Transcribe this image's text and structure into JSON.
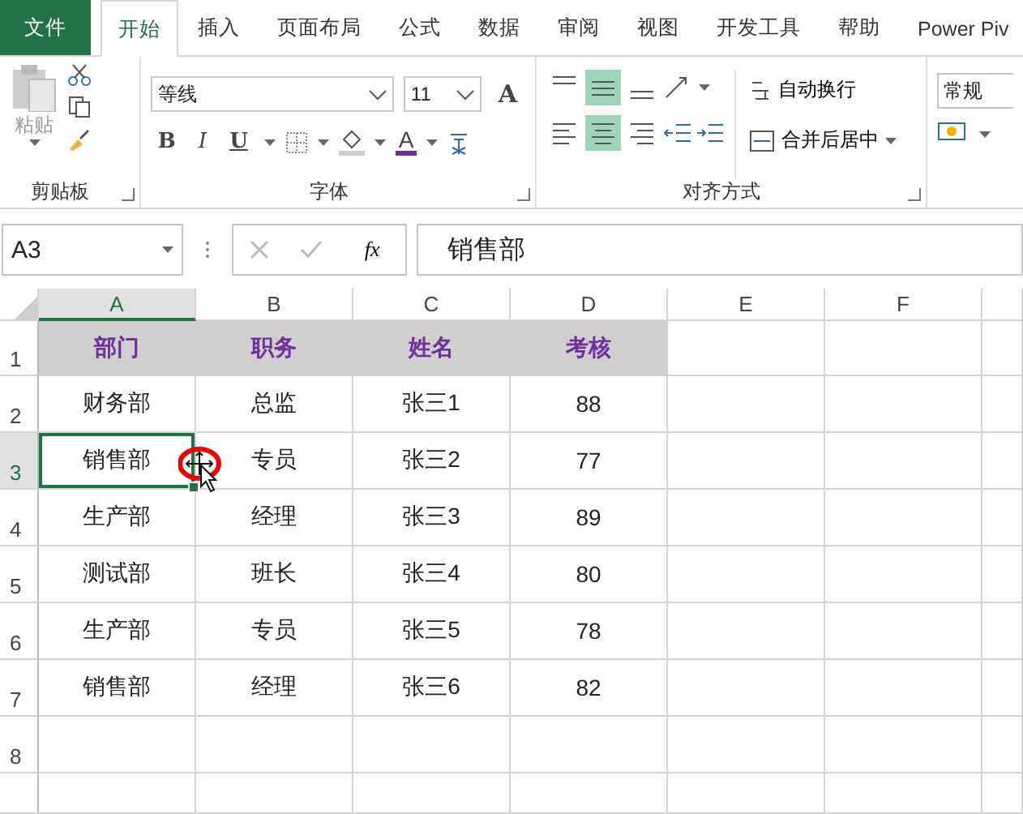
{
  "ribbon_tabs": [
    {
      "label": "文件",
      "kind": "file",
      "selected": false
    },
    {
      "label": "开始",
      "kind": "tab",
      "selected": true
    },
    {
      "label": "插入",
      "kind": "tab",
      "selected": false
    },
    {
      "label": "页面布局",
      "kind": "tab",
      "selected": false
    },
    {
      "label": "公式",
      "kind": "tab",
      "selected": false
    },
    {
      "label": "数据",
      "kind": "tab",
      "selected": false
    },
    {
      "label": "审阅",
      "kind": "tab",
      "selected": false
    },
    {
      "label": "视图",
      "kind": "tab",
      "selected": false
    },
    {
      "label": "开发工具",
      "kind": "tab",
      "selected": false
    },
    {
      "label": "帮助",
      "kind": "tab",
      "selected": false
    },
    {
      "label": "Power Piv",
      "kind": "tab",
      "selected": false
    }
  ],
  "clipboard": {
    "paste": "粘贴",
    "label": "剪贴板"
  },
  "font": {
    "name": "等线",
    "size": "11",
    "grow": "A",
    "styles": [
      "B",
      "I",
      "U"
    ],
    "color_letter": "A",
    "label": "字体"
  },
  "alignment": {
    "vertical": [
      {
        "kind": "top",
        "selected": false
      },
      {
        "kind": "middle",
        "selected": true
      },
      {
        "kind": "bottom",
        "selected": false
      }
    ],
    "horizontal": [
      {
        "kind": "left",
        "selected": false
      },
      {
        "kind": "center",
        "selected": true
      },
      {
        "kind": "right",
        "selected": false
      }
    ],
    "wrap_text": "自动换行",
    "merge": "合并后居中",
    "label": "对齐方式"
  },
  "number": {
    "format": "常规"
  },
  "formula_bar": {
    "name_box": "A3",
    "function_button": "fx",
    "formula": "销售部"
  },
  "sheet": {
    "columns": [
      {
        "label": "A",
        "selected": true
      },
      {
        "label": "B",
        "selected": false
      },
      {
        "label": "C",
        "selected": false
      },
      {
        "label": "D",
        "selected": false
      },
      {
        "label": "E",
        "selected": false
      },
      {
        "label": "F",
        "selected": false
      }
    ],
    "rows": [
      {
        "number": "1",
        "kind": "header",
        "selected": false,
        "cells": [
          {
            "text": "部门",
            "active": false
          },
          {
            "text": "职务",
            "active": false
          },
          {
            "text": "姓名",
            "active": false
          },
          {
            "text": "考核",
            "active": false
          }
        ]
      },
      {
        "number": "2",
        "kind": "data",
        "selected": false,
        "cells": [
          {
            "text": "财务部",
            "active": false
          },
          {
            "text": "总监",
            "active": false
          },
          {
            "text": "张三1",
            "active": false
          },
          {
            "text": "88",
            "active": false
          }
        ]
      },
      {
        "number": "3",
        "kind": "data",
        "selected": true,
        "cells": [
          {
            "text": "销售部",
            "active": true
          },
          {
            "text": "专员",
            "active": false
          },
          {
            "text": "张三2",
            "active": false
          },
          {
            "text": "77",
            "active": false
          }
        ]
      },
      {
        "number": "4",
        "kind": "data",
        "selected": false,
        "cells": [
          {
            "text": "生产部",
            "active": false
          },
          {
            "text": "经理",
            "active": false
          },
          {
            "text": "张三3",
            "active": false
          },
          {
            "text": "89",
            "active": false
          }
        ]
      },
      {
        "number": "5",
        "kind": "data",
        "selected": false,
        "cells": [
          {
            "text": "测试部",
            "active": false
          },
          {
            "text": "班长",
            "active": false
          },
          {
            "text": "张三4",
            "active": false
          },
          {
            "text": "80",
            "active": false
          }
        ]
      },
      {
        "number": "6",
        "kind": "data",
        "selected": false,
        "cells": [
          {
            "text": "生产部",
            "active": false
          },
          {
            "text": "专员",
            "active": false
          },
          {
            "text": "张三5",
            "active": false
          },
          {
            "text": "78",
            "active": false
          }
        ]
      },
      {
        "number": "7",
        "kind": "data",
        "selected": false,
        "cells": [
          {
            "text": "销售部",
            "active": false
          },
          {
            "text": "经理",
            "active": false
          },
          {
            "text": "张三6",
            "active": false
          },
          {
            "text": "82",
            "active": false
          }
        ]
      },
      {
        "number": "8",
        "selected": false,
        "cells": []
      }
    ]
  }
}
